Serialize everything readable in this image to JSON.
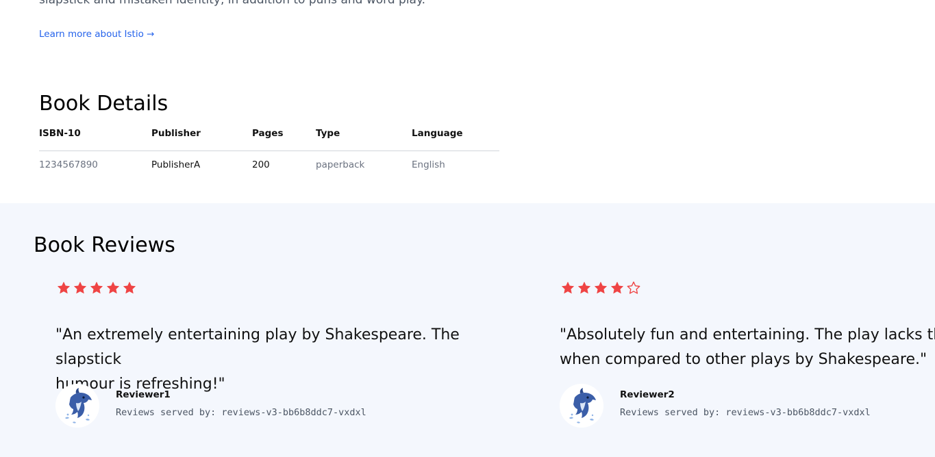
{
  "intro": {
    "text_fragment": "slapstick and mistaken identity, in addition to puns and word play.",
    "learn_more_label": "Learn more about Istio →"
  },
  "book_details": {
    "title": "Book Details",
    "headers": [
      "ISBN-10",
      "Publisher",
      "Pages",
      "Type",
      "Language"
    ],
    "values": [
      "1234567890",
      "PublisherA",
      "200",
      "paperback",
      "English"
    ]
  },
  "book_reviews": {
    "title": "Book Reviews",
    "star_color": "#ef4444",
    "reviews": [
      {
        "rating": 5,
        "max_rating": 5,
        "quote_line1": "\"An extremely entertaining play by Shakespeare. The slapstick",
        "quote_line2": "humour is refreshing!\"",
        "reviewer": "Reviewer1",
        "served_by": "Reviews served by: reviews-v3-bb6b8ddc7-vxdxl",
        "avatar_icon": "dolphin-icon"
      },
      {
        "rating": 4,
        "max_rating": 5,
        "quote_line1": "\"Absolutely fun and entertaining. The play lacks thematic depth",
        "quote_line2": "when compared to other plays by Shakespeare.\"",
        "reviewer": "Reviewer2",
        "served_by": "Reviews served by: reviews-v3-bb6b8ddc7-vxdxl",
        "avatar_icon": "dolphin-icon"
      }
    ]
  }
}
